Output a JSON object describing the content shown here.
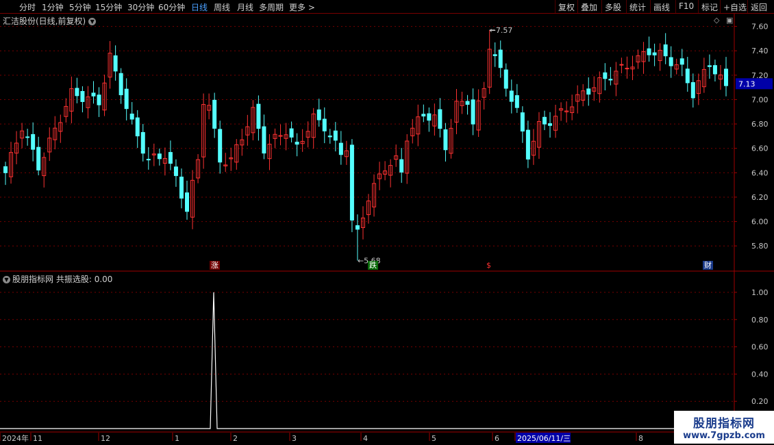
{
  "toolbar": {
    "periods": [
      "分时",
      "1分钟",
      "5分钟",
      "15分钟",
      "30分钟",
      "60分钟",
      "日线",
      "周线",
      "月线",
      "多周期",
      "更多 >"
    ],
    "active_period": "日线",
    "right_buttons": [
      "复权",
      "叠加",
      "多股",
      "统计",
      "画线",
      "F10",
      "标记",
      "+自选",
      "返回"
    ]
  },
  "main_chart": {
    "title": "汇洁股份(日线,前复权)",
    "price_ticks": [
      "7.60",
      "7.40",
      "7.20",
      "7.00",
      "6.80",
      "6.60",
      "6.40",
      "6.20",
      "6.00",
      "5.80"
    ],
    "current_price": "7.13",
    "high_label": "7.57",
    "low_label": "5.68",
    "event_tags": [
      {
        "text": "涨",
        "type": "up"
      },
      {
        "text": "跌",
        "type": "down"
      },
      {
        "text": "$",
        "type": "dividend"
      },
      {
        "text": "财",
        "type": "finance"
      }
    ]
  },
  "indicator": {
    "name": "股朋指标网",
    "series_label": "共振选股:",
    "value": "0.00",
    "ticks": [
      "1.00",
      "0.80",
      "0.60",
      "0.40",
      "0.20"
    ]
  },
  "date_axis": {
    "labels": [
      "2024年",
      "11",
      "12",
      "1",
      "2",
      "3",
      "4",
      "5",
      "6",
      "2025/06/11/三",
      "8"
    ],
    "selected_date": "2025/06/11/三"
  },
  "watermark": {
    "line1": "股朋指标网",
    "line2": "www.7gpzb.com"
  },
  "colors": {
    "up": "#ff3232",
    "down": "#54ffff",
    "grid": "#7a0000",
    "highlight": "#0000a8"
  },
  "chart_data": {
    "type": "candlestick",
    "ylim": [
      5.68,
      7.62
    ],
    "high": 7.57,
    "low": 5.68,
    "last": 7.13,
    "indicator_series": {
      "name": "共振选股",
      "ylim": [
        0,
        1.05
      ],
      "spike_value": 1.0,
      "baseline": 0.0
    }
  }
}
